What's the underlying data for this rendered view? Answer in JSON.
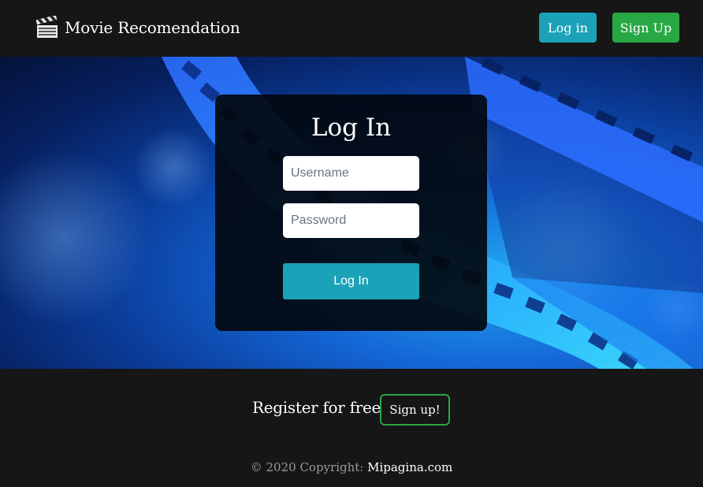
{
  "navbar": {
    "brand_icon": "clapperboard-icon",
    "brand_text": "Movie Recomendation",
    "login_label": "Log in",
    "signup_label": "Sign Up"
  },
  "login_card": {
    "title": "Log In",
    "username_placeholder": "Username",
    "password_placeholder": "Password",
    "submit_label": "Log In"
  },
  "footer": {
    "register_text": "Register for free",
    "register_button": "Sign up!",
    "copyright_prefix": "© 2020 Copyright: ",
    "copyright_link": "Mipagina.com"
  },
  "colors": {
    "navbar_bg": "#161616",
    "info": "#1ba2b8",
    "success": "#28a745",
    "hero_blue": "#1466d6"
  }
}
